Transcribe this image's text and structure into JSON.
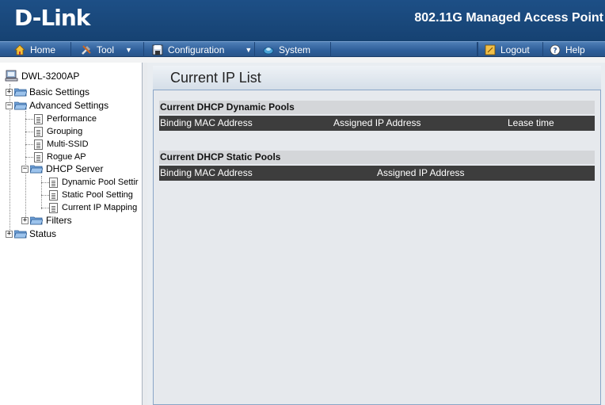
{
  "header": {
    "logo": "D-Link",
    "product": "802.11G Managed Access Point"
  },
  "menubar": {
    "home": "Home",
    "tool": "Tool",
    "configuration": "Configuration",
    "system": "System",
    "logout": "Logout",
    "help": "Help"
  },
  "tree": {
    "root": "DWL-3200AP",
    "basic_settings": "Basic Settings",
    "advanced_settings": "Advanced Settings",
    "performance": "Performance",
    "grouping": "Grouping",
    "multi_ssid": "Multi-SSID",
    "rogue_ap": "Rogue AP",
    "dhcp_server": "DHCP Server",
    "dynamic_pool": "Dynamic Pool Settir",
    "static_pool": "Static Pool Setting",
    "current_ip_mapping": "Current IP Mapping",
    "filters": "Filters",
    "status": "Status"
  },
  "content": {
    "title": "Current IP List",
    "dynamic_section": "Current DHCP Dynamic Pools",
    "dynamic_columns": [
      "Binding MAC Address",
      "Assigned IP Address",
      "Lease time"
    ],
    "static_section": "Current DHCP Static Pools",
    "static_columns": [
      "Binding MAC Address",
      "Assigned IP Address"
    ]
  },
  "colors": {
    "header_bg": "#164272",
    "menubar_bg": "#2e5e99",
    "table_head_bg": "#3d3d3d"
  }
}
